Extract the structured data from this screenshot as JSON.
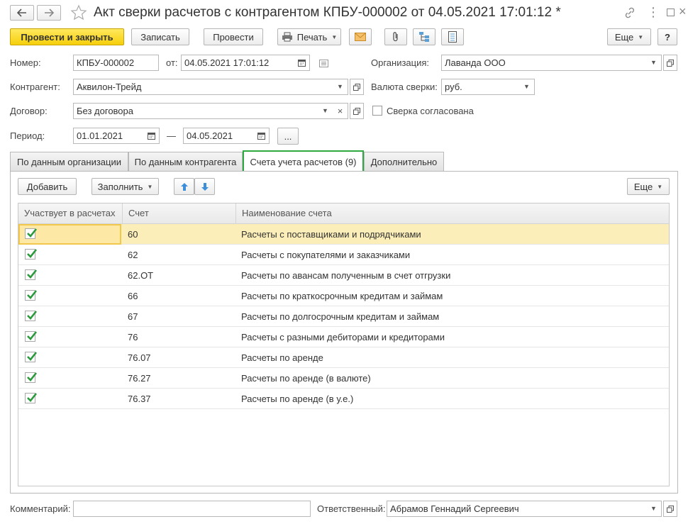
{
  "header": {
    "title": "Акт сверки расчетов с контрагентом КПБУ-000002 от 04.05.2021 17:01:12 *",
    "back_icon": "arrow-left-icon",
    "forward_icon": "arrow-right-icon",
    "favorite_icon": "star-icon",
    "link_icon": "link-icon",
    "menu_icon": "more-vertical-icon",
    "maximize_icon": "maximize-icon",
    "close_icon": "close-icon"
  },
  "toolbar": {
    "post_close": "Провести и закрыть",
    "save": "Записать",
    "post": "Провести",
    "print": "Печать",
    "more": "Еще",
    "help": "?"
  },
  "form": {
    "number_label": "Номер:",
    "number_value": "КПБУ-000002",
    "date_label": "от:",
    "date_value": "04.05.2021 17:01:12",
    "org_label": "Организация:",
    "org_value": "Лаванда ООО",
    "counterparty_label": "Контрагент:",
    "counterparty_value": "Аквилон-Трейд",
    "currency_label": "Валюта сверки:",
    "currency_value": "руб.",
    "contract_label": "Договор:",
    "contract_value": "Без договора",
    "agreed_label": "Сверка согласована",
    "agreed_checked": false,
    "period_label": "Период:",
    "period_from": "01.01.2021",
    "period_dash": "—",
    "period_to": "04.05.2021",
    "period_more": "..."
  },
  "tabs": [
    {
      "label": "По данным организации",
      "active": false
    },
    {
      "label": "По данным контрагента",
      "active": false
    },
    {
      "label": "Счета учета расчетов (9)",
      "active": true
    },
    {
      "label": "Дополнительно",
      "active": false
    }
  ],
  "table_toolbar": {
    "add": "Добавить",
    "fill": "Заполнить",
    "more": "Еще"
  },
  "table": {
    "columns": [
      "Участвует в расчетах",
      "Счет",
      "Наименование счета"
    ],
    "rows": [
      {
        "checked": true,
        "account": "60",
        "name": "Расчеты с поставщиками и подрядчиками",
        "selected": true
      },
      {
        "checked": true,
        "account": "62",
        "name": "Расчеты с покупателями и заказчиками"
      },
      {
        "checked": true,
        "account": "62.ОТ",
        "name": "Расчеты по авансам полученным в счет отгрузки"
      },
      {
        "checked": true,
        "account": "66",
        "name": "Расчеты по краткосрочным кредитам и займам"
      },
      {
        "checked": true,
        "account": "67",
        "name": "Расчеты по долгосрочным кредитам и займам"
      },
      {
        "checked": true,
        "account": "76",
        "name": "Расчеты с разными дебиторами и кредиторами"
      },
      {
        "checked": true,
        "account": "76.07",
        "name": "Расчеты по аренде"
      },
      {
        "checked": true,
        "account": "76.27",
        "name": "Расчеты по аренде (в валюте)"
      },
      {
        "checked": true,
        "account": "76.37",
        "name": "Расчеты по аренде (в у.е.)"
      }
    ]
  },
  "footer": {
    "comment_label": "Комментарий:",
    "comment_value": "",
    "responsible_label": "Ответственный:",
    "responsible_value": "Абрамов Геннадий Сергеевич"
  },
  "colors": {
    "primary_button": "#f6cf0b",
    "active_tab_border": "#2eaa40",
    "selected_row": "#fbeeb8",
    "checkmark": "#2b9a3c"
  }
}
